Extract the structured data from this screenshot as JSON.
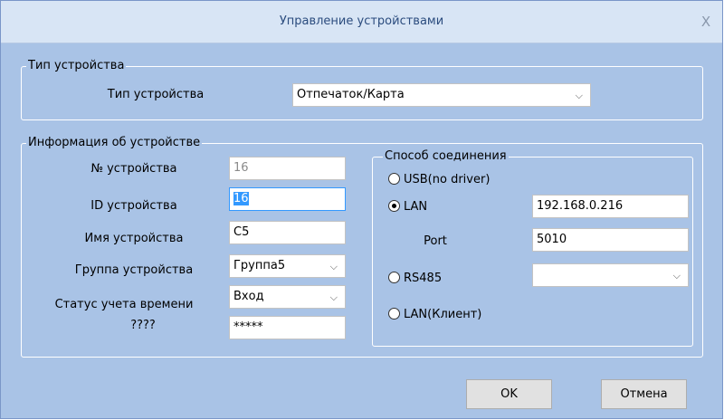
{
  "window": {
    "title": "Управление устройствами",
    "close_glyph": "X"
  },
  "device_type_group": {
    "legend": "Тип устройства",
    "label": "Тип устройства",
    "value": "Отпечаток/Карта"
  },
  "device_info": {
    "legend": "Информация об устройстве",
    "number_label": "№ устройства",
    "number_value": "16",
    "id_label": "ID устройства",
    "id_value": "16",
    "name_label": "Имя устройства",
    "name_value": "C5",
    "group_label": "Группа устройства",
    "group_value": "Группа5",
    "status_label": "Статус учета времени",
    "status_value": "Вход",
    "password_label": "????",
    "password_value": "*****"
  },
  "connection": {
    "legend": "Способ соединения",
    "usb_label": "USB(no driver)",
    "lan_label": "LAN",
    "lan_ip": "192.168.0.216",
    "port_label": "Port",
    "port_value": "5010",
    "rs485_label": "RS485",
    "rs485_value": "",
    "lan_client_label": "LAN(Клиент)",
    "selected": "LAN"
  },
  "buttons": {
    "ok": "OK",
    "cancel": "Отмена"
  },
  "colors": {
    "dialog_bg": "#a9c3e6",
    "titlebar_bg": "#d8e5f5",
    "title_text": "#2b4c7e"
  }
}
